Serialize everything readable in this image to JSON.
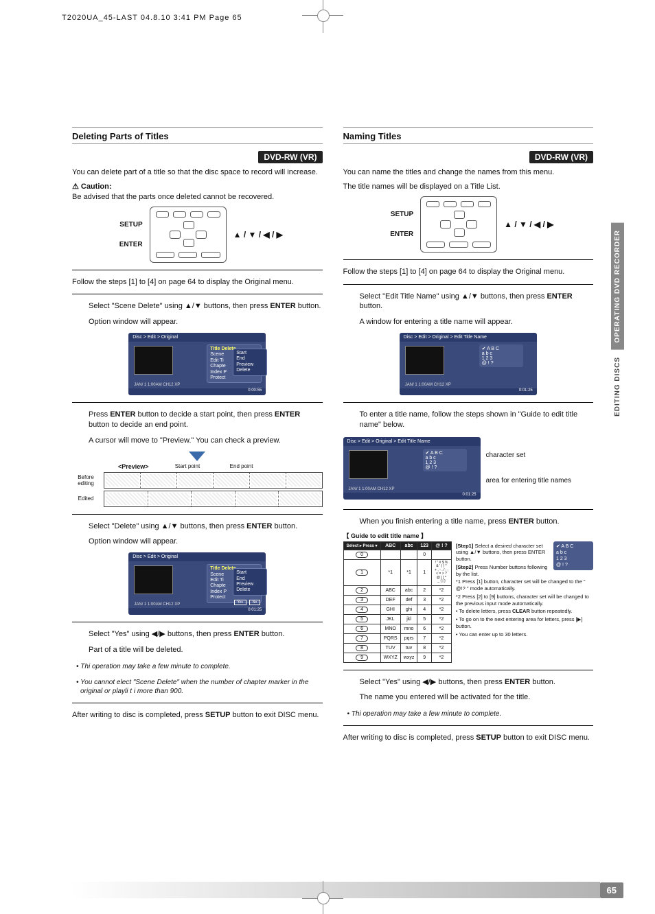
{
  "header_line": "T2020UA_45-LAST  04.8.10 3:41 PM  Page 65",
  "page_number": "65",
  "side_tab_1": "OPERATING DVD RECORDER",
  "side_tab_2": "EDITING DISCS",
  "arrows_glyphs": "▲ / ▼ / ◀ / ▶",
  "left": {
    "title": "Deleting Parts of Titles",
    "badge": "DVD-RW (VR)",
    "intro": "You can delete part of a title so that the disc space to record will increase.",
    "caution_label": "Caution:",
    "caution_text": "Be advised that the parts once deleted cannot be recovered.",
    "remote_setup": "SETUP",
    "remote_enter": "ENTER",
    "para2": "Follow the steps [1] to [4] on page 64 to display the Original menu.",
    "step1a": "Select \"Scene Delete\" using ▲/▼ buttons, then press ",
    "step1b": " button.",
    "step1_after": "Option window will appear.",
    "osd1": {
      "path": "Disc > Edit > Original",
      "menu_title": "Title Delete",
      "items": [
        "Scene",
        "Edit Ti",
        "Chapte",
        "Index P",
        "Protect"
      ],
      "sub": [
        "Start",
        "End",
        "Preview",
        "Delete"
      ],
      "info": "JAN/ 1   1:00AM  CH12    XP",
      "time": "0:00:55"
    },
    "step2a": "Press ",
    "step2b": " button to decide a start point, then press ",
    "step2c": " button to decide an end point.",
    "step2_after": "A cursor will move to \"Preview.\"  You can check a preview.",
    "preview": {
      "label": "<Preview>",
      "start": "Start point",
      "end": "End point",
      "before": "Before editing",
      "after": "Edited"
    },
    "step3a": "Select \"Delete\" using ▲/▼ buttons, then press ",
    "step3b": " button.",
    "step3_after": "Option window will appear.",
    "osd2": {
      "path": "Disc > Edit > Original",
      "menu_title": "Title Delete",
      "items": [
        "Scene",
        "Edit Ti",
        "Chapte",
        "Index P",
        "Protect"
      ],
      "sub": [
        "Start",
        "End",
        "Preview",
        "Delete"
      ],
      "yes": "Yes",
      "no": "No",
      "info": "JAN/ 1   1:00AM  CH12    XP",
      "time": "0:01:25"
    },
    "step4a": "Select \"Yes\" using ◀/▶ buttons, then press ",
    "step4b": " button.",
    "step4_after": "Part of a title will be deleted.",
    "note1": "• Thi   operation may take a few minute   to complete.",
    "note2": "• You cannot   elect \"Scene Delete\" when the number of chapter marker   in the original or playli  t i   more than 900.",
    "final": "After writing to disc is completed, press SETUP button to exit DISC menu."
  },
  "right": {
    "title": "Naming Titles",
    "badge": "DVD-RW (VR)",
    "intro": "You can name the titles and change the names from this menu.",
    "intro2": "The title names will be displayed on a Title List.",
    "remote_setup": "SETUP",
    "remote_enter": "ENTER",
    "para2": "Follow the steps [1] to [4] on page 64 to display the Original menu.",
    "step1a": "Select \"Edit Title Name\" using ▲/▼ buttons, then press ",
    "step1b": " button.",
    "step1_after": "A window for entering a title name will appear.",
    "osd1": {
      "path": "Disc > Edit > Original > Edit Title Name",
      "charset": [
        "✔ A B C",
        "   a b c",
        "   1 2 3",
        "   @ ! ?"
      ],
      "info": "JAN/ 1   1:00AM  CH12    XP",
      "time": "0:01:25"
    },
    "step2a": "To enter a title name, follow the steps shown in \"Guide to edit title name\" below.",
    "osd2_callout1": "character set",
    "osd2_callout2": "area for entering title names",
    "step3a": "When you finish entering a title name, press ",
    "step3b": " button.",
    "guide_title": " Guide to edit title name ",
    "guide": {
      "diag": "Select ▸ Press ▾",
      "cols": [
        "ABC",
        "abc",
        "123",
        "@ ! ?"
      ],
      "rows": [
        {
          "k": "0",
          "c": [
            "<space>",
            "<space>",
            "0",
            "<space>"
          ]
        },
        {
          "k": "1",
          "c": [
            "*1",
            "*1",
            "1",
            "! \" # $ %\n& ' ( ) *\n+ , - . / : ;\n< = > ?\n@ [ ] ^\n_ { | }"
          ]
        },
        {
          "k": "2",
          "c": [
            "ABC",
            "abc",
            "2",
            "*2"
          ]
        },
        {
          "k": "3",
          "c": [
            "DEF",
            "def",
            "3",
            "*2"
          ]
        },
        {
          "k": "4",
          "c": [
            "GHI",
            "ghi",
            "4",
            "*2"
          ]
        },
        {
          "k": "5",
          "c": [
            "JKL",
            "jkl",
            "5",
            "*2"
          ]
        },
        {
          "k": "6",
          "c": [
            "MNO",
            "mno",
            "6",
            "*2"
          ]
        },
        {
          "k": "7",
          "c": [
            "PQRS",
            "pqrs",
            "7",
            "*2"
          ]
        },
        {
          "k": "8",
          "c": [
            "TUV",
            "tuv",
            "8",
            "*2"
          ]
        },
        {
          "k": "9",
          "c": [
            "WXYZ",
            "wxyz",
            "9",
            "*2"
          ]
        }
      ],
      "right": {
        "s1": "[Step1] Select a desired character set using ▲/▼ buttons, then press ENTER button.",
        "box": [
          "✔ A B C",
          "   a b c",
          "   1 2 3",
          "   @ ! ?"
        ],
        "s2": "[Step2] Press Number buttons following by the list.",
        "n1": "*1 Press [1] button, character set will be changed to the \" @!? \" mode automatically.",
        "n2": "*2 Press [2] to [9] buttons, character set will be changed to the previous input mode automatically.",
        "b1": "• To delete letters, press CLEAR button repeatedly.",
        "b2": "• To go on to the next entering area for letters, press [▶] button.",
        "b3": "• You can enter up to 30 letters."
      }
    },
    "step4a": "Select \"Yes\" using ◀/▶ buttons, then press ",
    "step4b": " button.",
    "step4_after": "The name you entered will be activated for the title.",
    "note1": "• Thi   operation may take a few minute   to complete.",
    "final": "After writing to disc is completed, press SETUP button to exit DISC menu."
  }
}
